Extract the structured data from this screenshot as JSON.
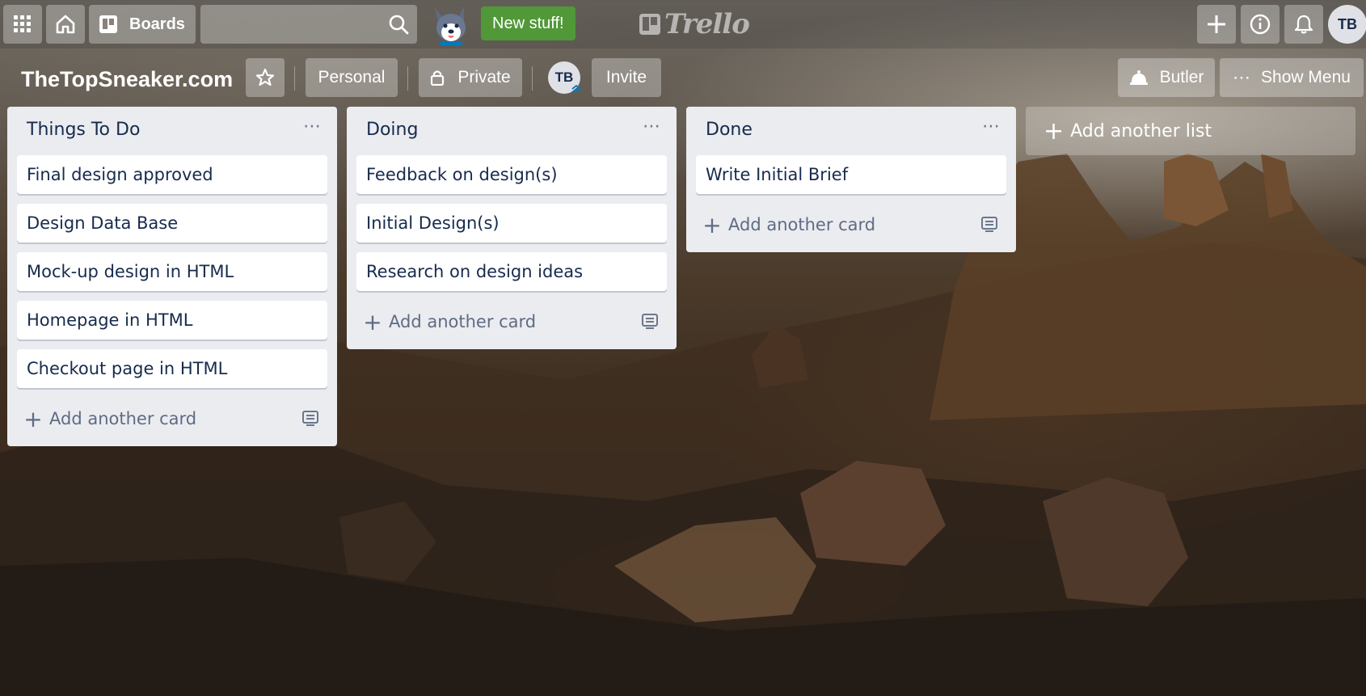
{
  "topbar": {
    "apps_icon": "grid-icon",
    "home_icon": "home-icon",
    "boards_label": "Boards",
    "search_placeholder": "",
    "new_stuff_label": "New stuff!",
    "logo_text": "Trello",
    "avatar_initials": "TB"
  },
  "board": {
    "title": "TheTopSneaker.com",
    "personal_label": "Personal",
    "private_label": "Private",
    "member_initials": "TB",
    "invite_label": "Invite",
    "butler_label": "Butler",
    "show_menu_label": "Show Menu"
  },
  "lists": [
    {
      "title": "Things To Do",
      "cards": [
        "Final design approved",
        "Design Data Base",
        "Mock-up design in HTML",
        "Homepage in HTML",
        "Checkout page in HTML"
      ],
      "add_card_label": "Add another card"
    },
    {
      "title": "Doing",
      "cards": [
        "Feedback on design(s)",
        "Initial Design(s)",
        "Research on design ideas"
      ],
      "add_card_label": "Add another card"
    },
    {
      "title": "Done",
      "cards": [
        "Write Initial Brief"
      ],
      "add_card_label": "Add another card"
    }
  ],
  "add_list_label": "Add another list",
  "colors": {
    "list_bg": "#ebecf0",
    "card_bg": "#ffffff",
    "text": "#172b4d",
    "muted": "#5e6c84",
    "new_stuff_green": "#519839"
  }
}
